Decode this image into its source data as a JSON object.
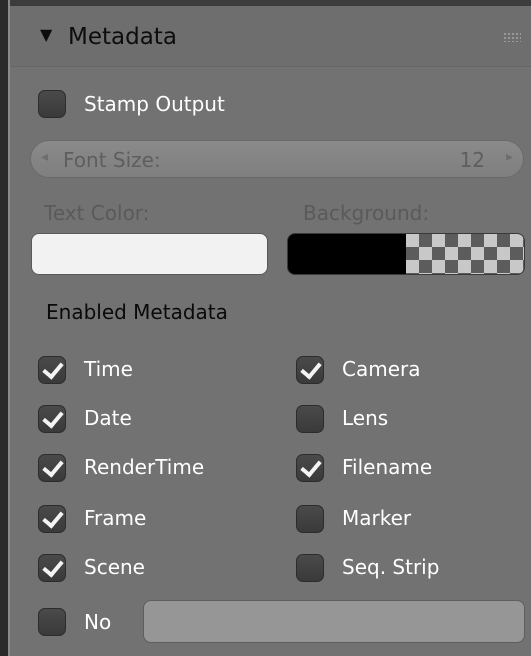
{
  "panel": {
    "title": "Metadata",
    "stamp_output": {
      "label": "Stamp Output",
      "checked": false
    },
    "font_size": {
      "label": "Font Size:",
      "value": "12"
    },
    "text_color": {
      "label": "Text Color:",
      "color": "#f2f2f2"
    },
    "background": {
      "label": "Background:",
      "color": "#000000"
    },
    "enabled_metadata_heading": "Enabled Metadata",
    "left_items": [
      {
        "label": "Time",
        "checked": true
      },
      {
        "label": "Date",
        "checked": true
      },
      {
        "label": "RenderTime",
        "checked": true
      },
      {
        "label": "Frame",
        "checked": true
      },
      {
        "label": "Scene",
        "checked": true
      }
    ],
    "right_items": [
      {
        "label": "Camera",
        "checked": true
      },
      {
        "label": "Lens",
        "checked": false
      },
      {
        "label": "Filename",
        "checked": true
      },
      {
        "label": "Marker",
        "checked": false
      },
      {
        "label": "Seq. Strip",
        "checked": false
      }
    ],
    "note": {
      "label": "No",
      "checked": false,
      "value": ""
    }
  }
}
